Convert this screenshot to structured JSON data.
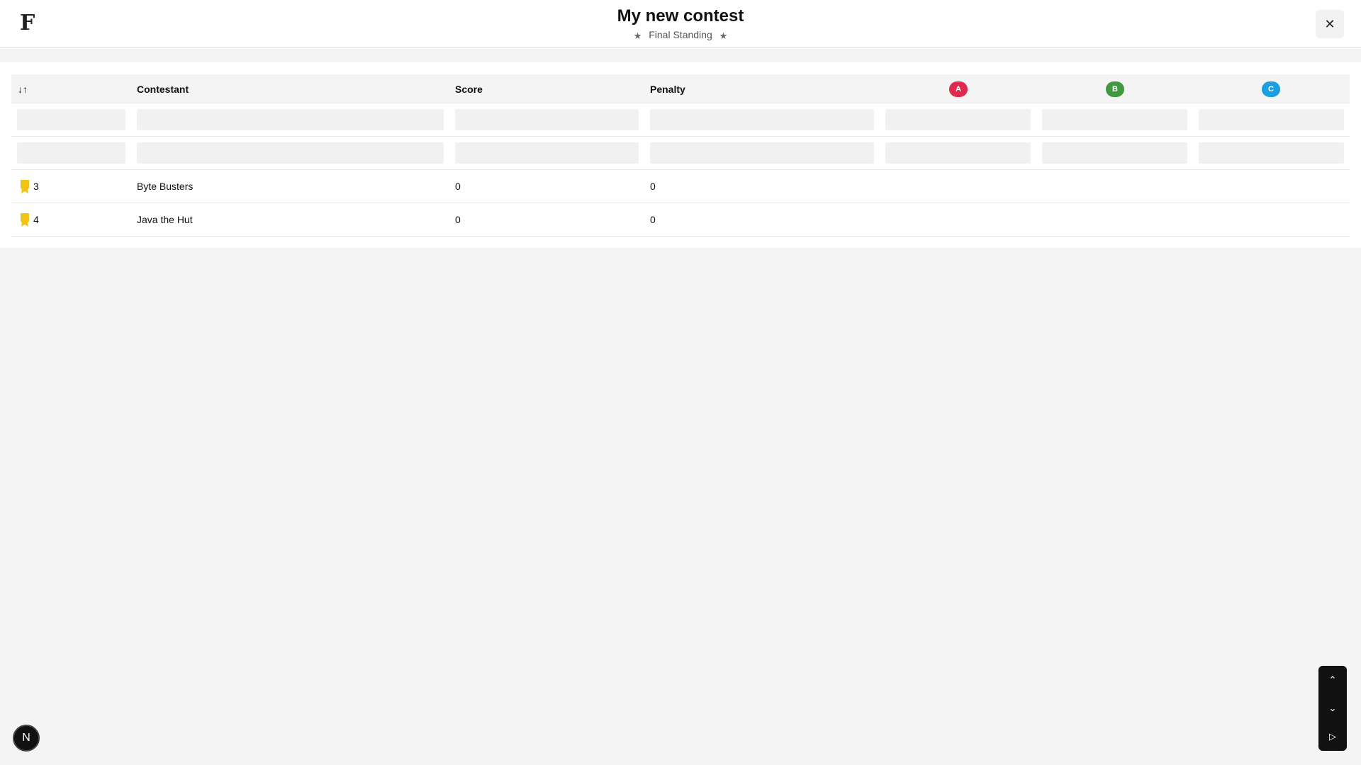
{
  "header": {
    "logo_letter": "F",
    "title": "My new contest",
    "subtitle": "Final Standing",
    "star_glyph": "★",
    "close_glyph": "✕"
  },
  "table": {
    "columns": {
      "sort_glyph": "↓↑",
      "contestant": "Contestant",
      "score": "Score",
      "penalty": "Penalty"
    },
    "problems": [
      {
        "label": "A",
        "color": "#e0294f"
      },
      {
        "label": "B",
        "color": "#3f9a3f"
      },
      {
        "label": "C",
        "color": "#1a9fe0"
      }
    ],
    "rows": [
      {
        "rank": "3",
        "name": "Byte Busters",
        "score": "0",
        "penalty": "0"
      },
      {
        "rank": "4",
        "name": "Java the Hut",
        "score": "0",
        "penalty": "0"
      }
    ],
    "medal_color": "#f2c314"
  },
  "controls": {
    "up_glyph": "⌃",
    "down_glyph": "⌄",
    "play_glyph": "▷",
    "avatar_letter": "N"
  }
}
